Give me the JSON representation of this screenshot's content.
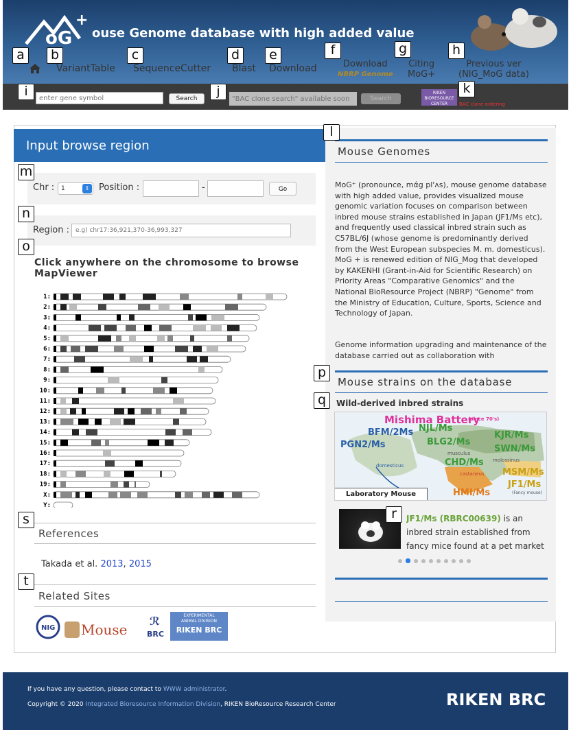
{
  "header": {
    "site_title": "ouse Genome database with high added value"
  },
  "nav": {
    "home_icon": "home-icon",
    "items": [
      {
        "label": "VariantTable"
      },
      {
        "label": "SequenceCutter"
      },
      {
        "label": "Blast"
      },
      {
        "label": "Download"
      }
    ],
    "download_nbrp": {
      "line1": "Download",
      "line2": "NBRP Genome"
    },
    "citing": {
      "line1": "Citing",
      "line2": "MoG+"
    },
    "previous": {
      "line1": "Previous ver",
      "line2": "(NIG_MoG data)"
    }
  },
  "searchbar": {
    "gene_placeholder": "enter gene symbol",
    "gene_search_label": "Search",
    "bac_placeholder": "\"BAC clone search\" available soon",
    "bac_search_label": "Search",
    "riken_logo_text": "RIKEN BIORESOURCE CENTER",
    "bac_order_text": "BAC clone ordering"
  },
  "left": {
    "title": "Input browse region",
    "chr_label": "Chr :",
    "chr_value": "1",
    "position_label": "Position :",
    "dash": "-",
    "go_label": "Go",
    "region_label": "Region :",
    "region_placeholder": "e.g) chr17:36,921,370-36,993,327",
    "click_title": "Click anywhere on the chromosome to browse MapViewer",
    "chromosomes": [
      "1:",
      "2:",
      "3:",
      "4:",
      "5:",
      "6:",
      "7:",
      "8:",
      "9:",
      "10:",
      "11:",
      "12:",
      "13:",
      "14:",
      "15:",
      "16:",
      "17:",
      "18:",
      "19:",
      "X:",
      "Y:"
    ],
    "references_title": "References",
    "references_prefix": "Takada et al.",
    "ref_2013": "2013",
    "ref_sep": ",",
    "ref_2015": "2015",
    "related_title": "Related Sites",
    "related_nig": "NIG",
    "related_mouse": "Mouse",
    "related_brc": "BRC",
    "related_exp_line1": "EXPERIMENTAL",
    "related_exp_line2": "ANIMAL DIVISION",
    "related_exp_brc": "RIKEN BRC"
  },
  "right": {
    "genomes_title": "Mouse Genomes",
    "genomes_text_1": "MoG⁺ (pronounce, mάg pl'ʌs), mouse genome database with high added value, provides visualized mouse genomic variation focuses on comparison between inbred mouse strains established in Japan (JF1/Ms etc), and frequently used classical inbred strain such as C57BL/6J (whose genome is predominantly derived from the West European subspecies M. m. domesticus). MoG + is renewed edition of NIG_Mog that developed by KAKENHI (Grant-in-Aid for Scientific Research) on Priority Areas \"Comparative Genomics\" and the National BioResource Project (NBRP) \"Genome\" from the Ministry of Education, Culture, Sports, Science and Technology of Japan.",
    "genomes_text_2": "Genome information upgrading and maintenance of the database carried out as collaboration with",
    "strains_title": "Mouse strains on the database",
    "wild_title": "Wild-derived inbred strains",
    "map": {
      "mishima": "Mishima Battery",
      "since": "(since 70's)",
      "bfm": "BFM/2Ms",
      "njl": "NJL/Ms",
      "pgn": "PGN2/Ms",
      "blg": "BLG2/Ms",
      "kjr": "KJR/Ms",
      "swn": "SWN/Ms",
      "musculus": "musculus",
      "molossinus": "molossinus",
      "domesticus": "domesticus",
      "chd": "CHD/Ms",
      "castaneus": "castaneus",
      "msm": "MSM/Ms",
      "jf1": "JF1/Ms",
      "fancy": "(Fancy mouse)",
      "hmi": "HMI/Ms",
      "lab": "Laboratory Mouse"
    },
    "strain_name": "JF1/Ms (RBRC00639)",
    "strain_text": "is an inbred strain established from fancy mice found at a pet market"
  },
  "footer": {
    "line1_prefix": "If you have any question, please contact to",
    "line1_link": "WWW administrator",
    "line1_suffix": ".",
    "line2_prefix": "Copyright © 2020",
    "line2_link": "Integrated Bioresource Information Division",
    "line2_suffix": ", RIKEN BioResource Research Center",
    "logo": "RIKEN BRC"
  },
  "callouts": [
    "a",
    "b",
    "c",
    "d",
    "e",
    "f",
    "g",
    "h",
    "i",
    "j",
    "k",
    "l",
    "m",
    "n",
    "o",
    "p",
    "q",
    "r",
    "s",
    "t"
  ]
}
